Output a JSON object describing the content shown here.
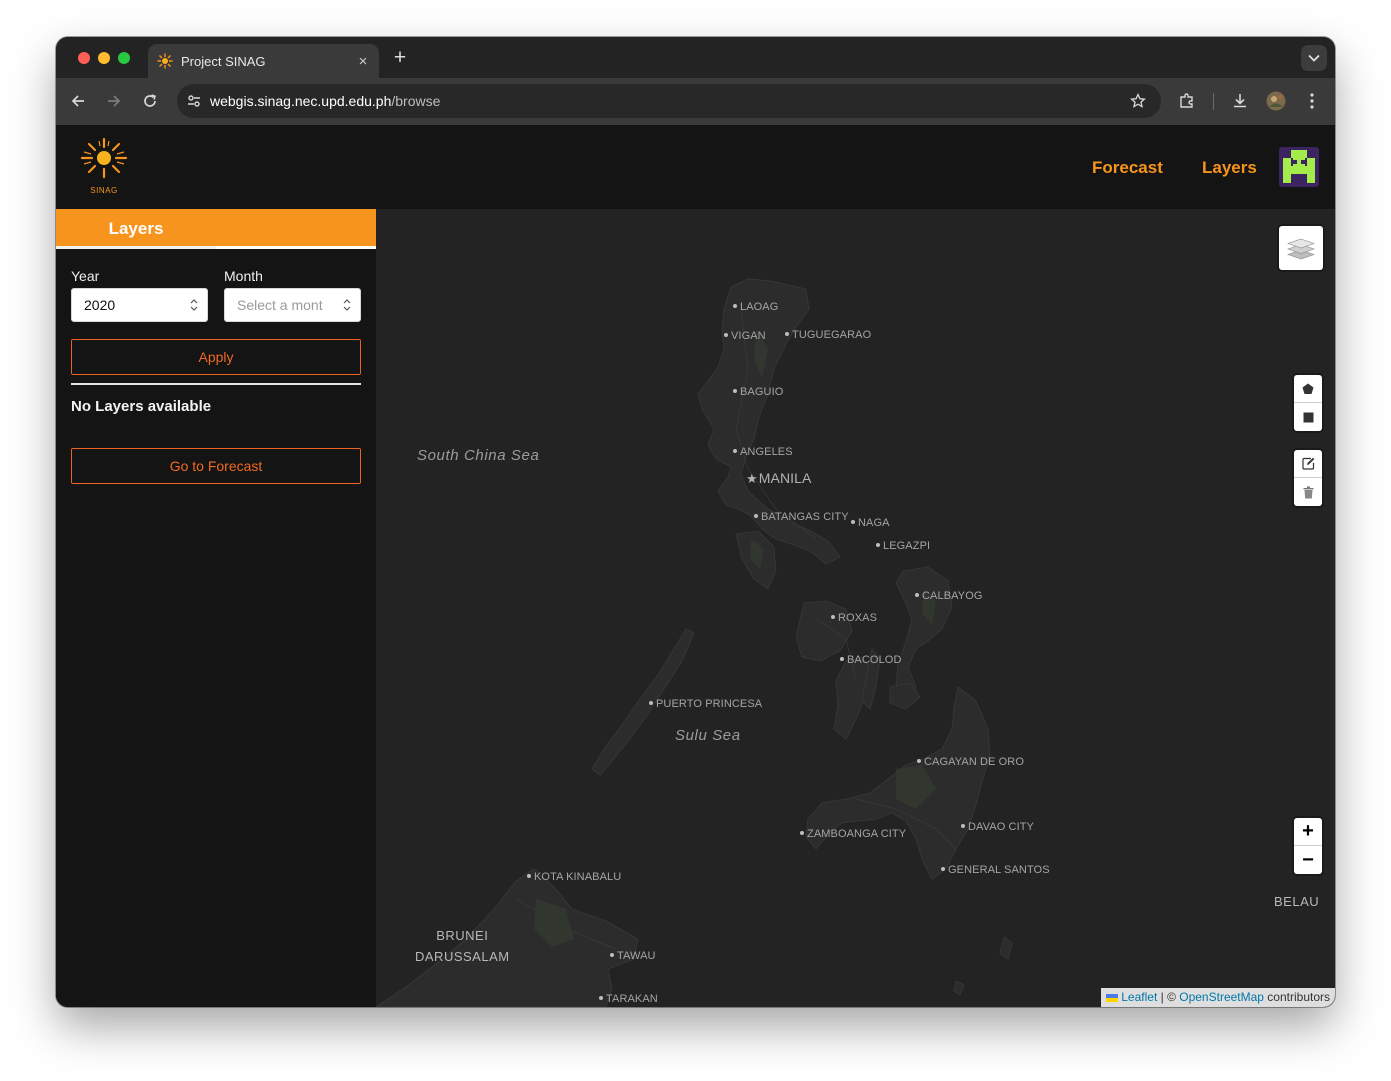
{
  "browser": {
    "tab_title": "Project SINAG",
    "tab_close": "×",
    "new_tab": "+",
    "url_host": "webgis.sinag.nec.upd.edu.ph",
    "url_path": "/browse"
  },
  "header": {
    "logo_text": "SINAG",
    "nav": {
      "forecast": "Forecast",
      "layers": "Layers"
    }
  },
  "sidebar": {
    "tab_label": "Layers",
    "year_label": "Year",
    "year_value": "2020",
    "month_label": "Month",
    "month_placeholder": "Select a mont",
    "apply_label": "Apply",
    "no_layers": "No Layers available",
    "goto_forecast": "Go to Forecast"
  },
  "map": {
    "seas": [
      "South China Sea",
      "Sulu Sea"
    ],
    "countries": {
      "brunei_line1": "BRUNEI",
      "brunei_line2": "DARUSSALAM",
      "belau": "BELAU"
    },
    "capital": "MANILA",
    "cities": [
      "LAOAG",
      "VIGAN",
      "TUGUEGARAO",
      "BAGUIO",
      "ANGELES",
      "BATANGAS CITY",
      "NAGA",
      "LEGAZPI",
      "CALBAYOG",
      "ROXAS",
      "BACOLOD",
      "PUERTO PRINCESA",
      "CAGAYAN DE ORO",
      "ZAMBOANGA CITY",
      "DAVAO CITY",
      "GENERAL SANTOS",
      "KOTA KINABALU",
      "TAWAU",
      "TARAKAN"
    ],
    "zoom_in": "+",
    "zoom_out": "−",
    "attribution": {
      "leaflet": "Leaflet",
      "sep": " | © ",
      "osm": "OpenStreetMap",
      "suffix": " contributors"
    }
  },
  "colors": {
    "accent": "#f7941d",
    "button_outline": "#e8641f",
    "map_bg": "#232323",
    "land": "#2b2b2b"
  }
}
